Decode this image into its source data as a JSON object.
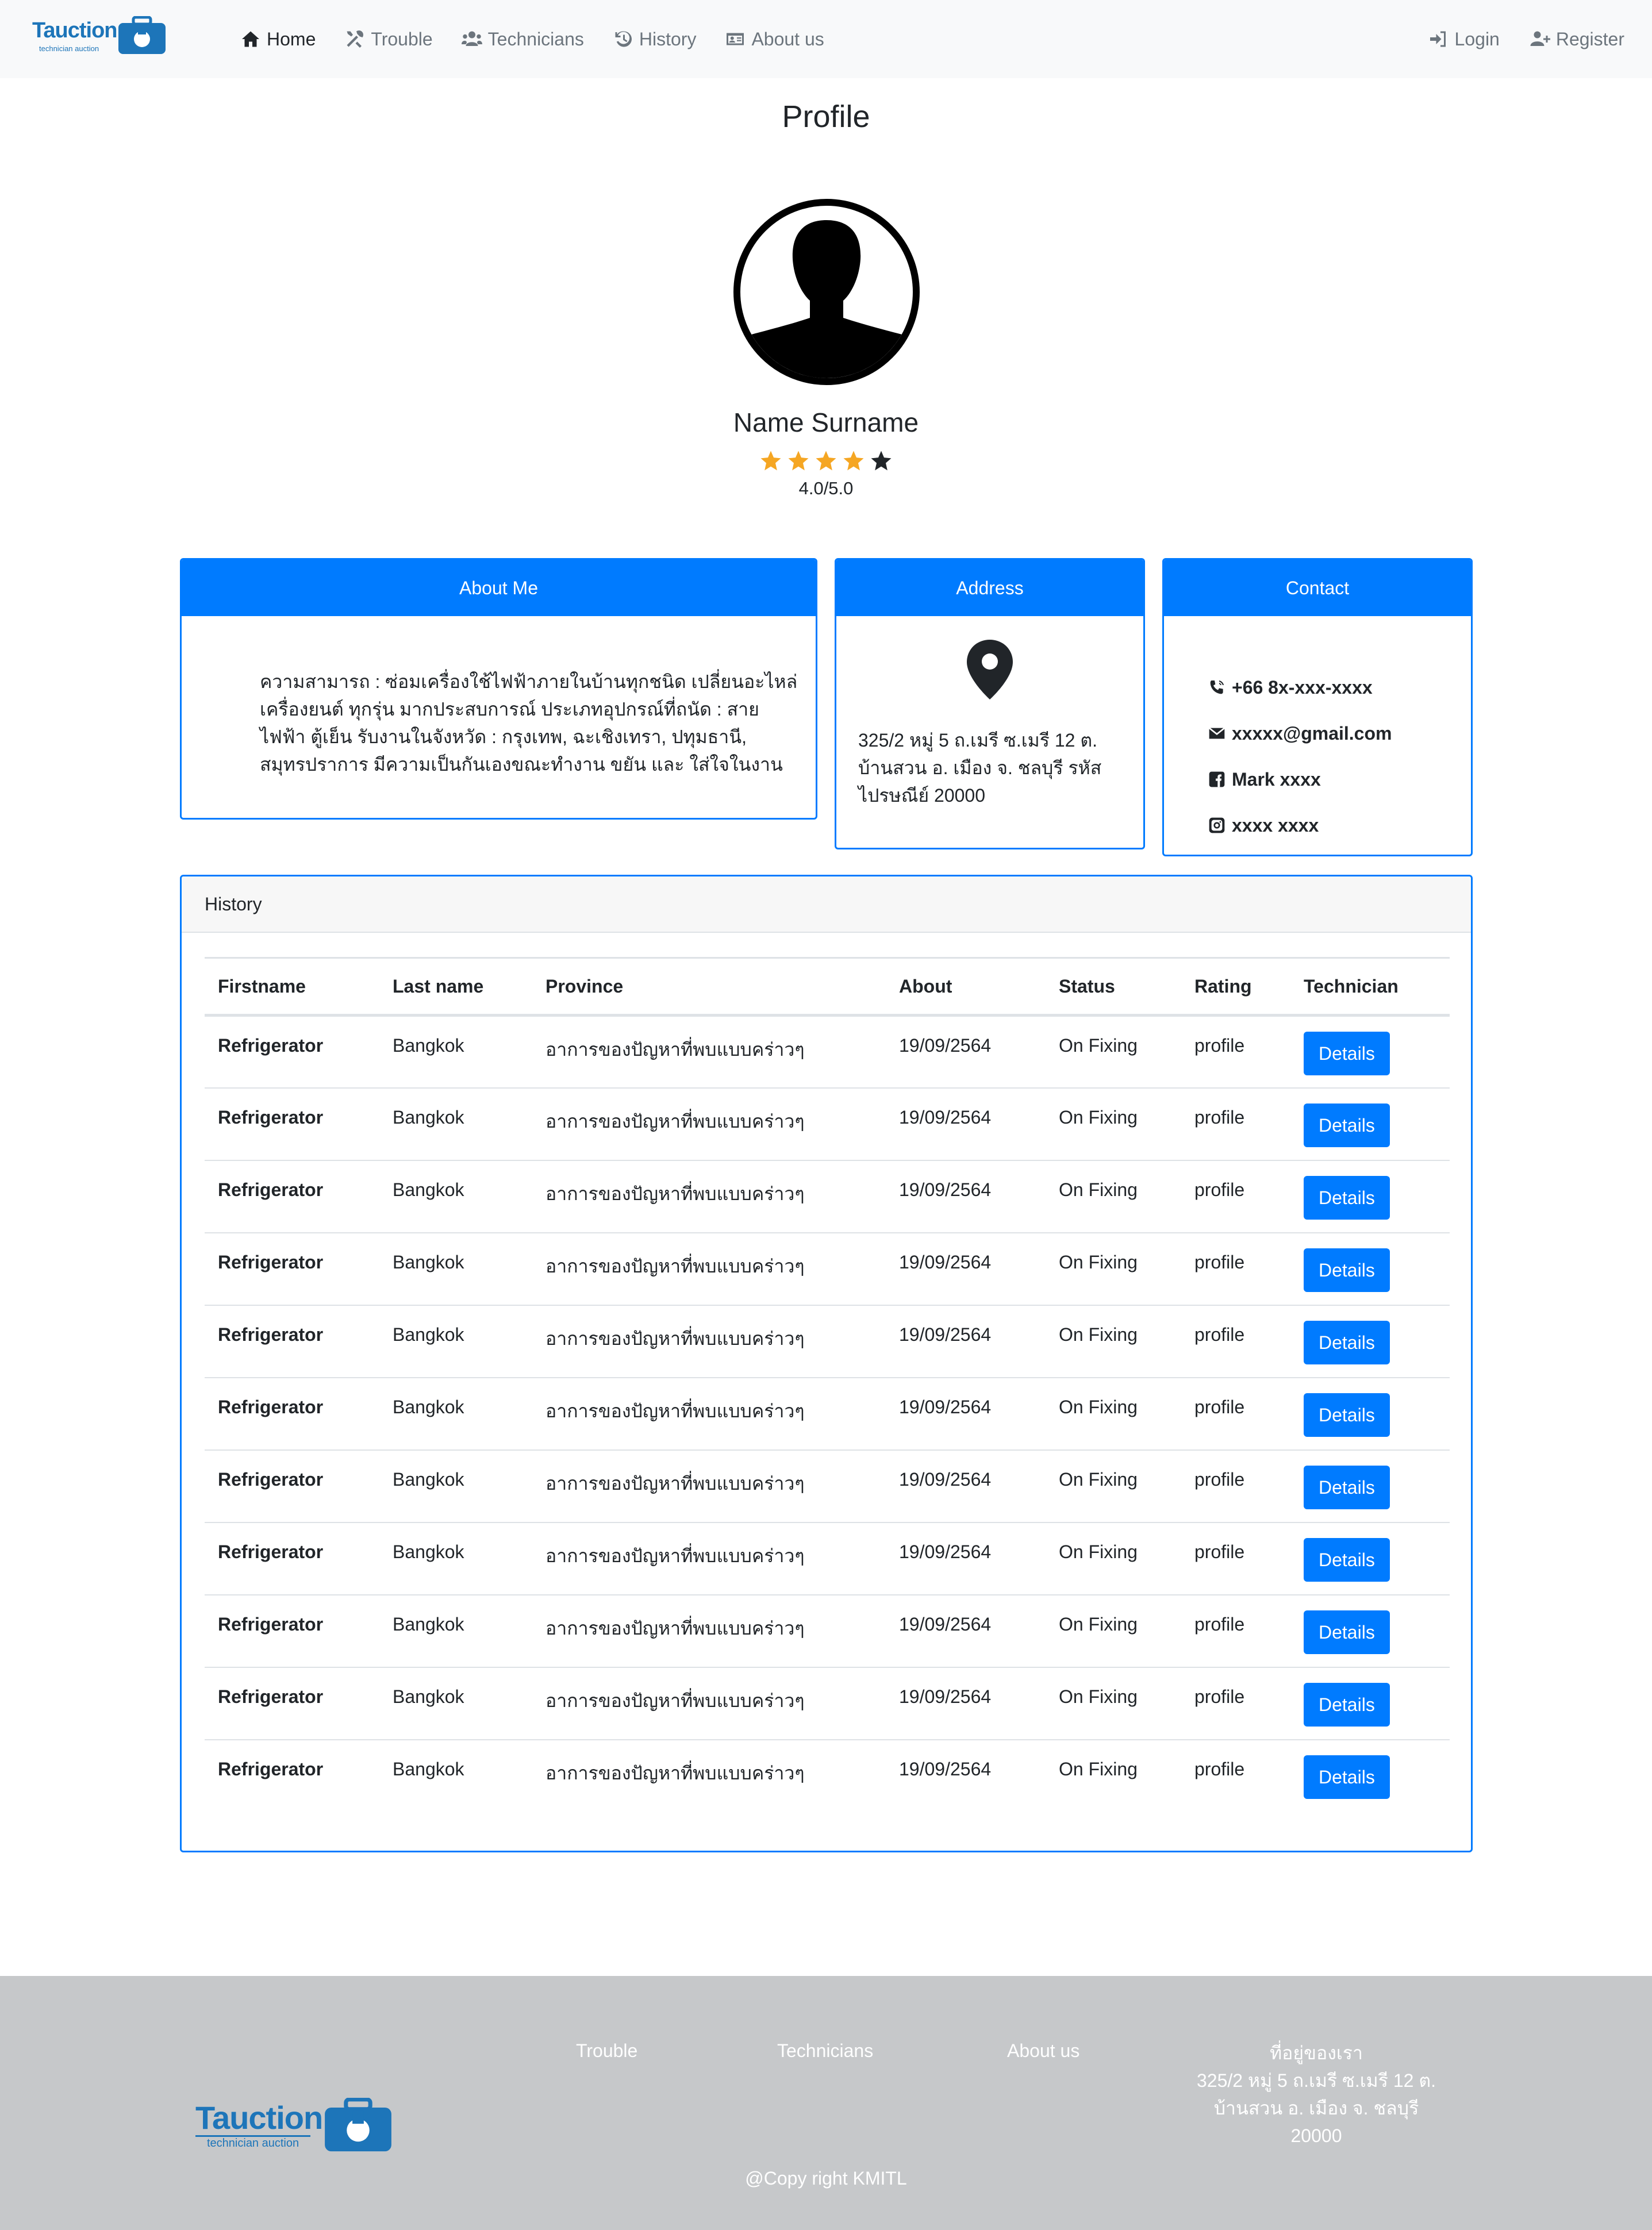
{
  "brand": {
    "name": "Tauction",
    "tagline": "technician auction",
    "color": "#1d75b9"
  },
  "nav": {
    "left": [
      {
        "label": "Home",
        "icon": "home-icon",
        "active": true
      },
      {
        "label": "Trouble",
        "icon": "tools-icon"
      },
      {
        "label": "Technicians",
        "icon": "users-icon"
      },
      {
        "label": "History",
        "icon": "history-icon"
      },
      {
        "label": "About us",
        "icon": "id-card-icon"
      }
    ],
    "right": [
      {
        "label": "Login",
        "icon": "sign-in-icon"
      },
      {
        "label": "Register",
        "icon": "user-plus-icon"
      }
    ]
  },
  "profile": {
    "title": "Profile",
    "name": "Name Surname",
    "rating": 4,
    "rating_max": 5,
    "rating_text": "4.0/5.0",
    "star_color": "#f5a623"
  },
  "about": {
    "header": "About Me",
    "text": "ความสามารถ : ซ่อมเครื่องใช้ไฟฟ้าภายในบ้านทุกชนิด เปลี่ยนอะไหล่เครื่องยนต์ ทุกรุ่น มากประสบการณ์ ประเภทอุปกรณ์ที่ถนัด : สายไฟฟ้า ตู้เย็น รับงานในจังหวัด : กรุงเทพ, ฉะเชิงเทรา, ปทุมธานี, สมุทรปราการ มีความเป็นกันเองขณะทำงาน ขยัน และ ใส่ใจในงาน"
  },
  "address": {
    "header": "Address",
    "text": "325/2 หมู่ 5 ถ.เมรี ซ.เมรี 12 ต. บ้านสวน อ. เมือง จ. ชลบุรี รหัสไปรษณีย์ 20000"
  },
  "contact": {
    "header": "Contact",
    "phone": "+66 8x-xxx-xxxx",
    "email": "xxxxx@gmail.com",
    "facebook": "Mark xxxx",
    "instagram": "xxxx xxxx"
  },
  "history": {
    "header": "History",
    "columns": [
      "Firstname",
      "Last name",
      "Province",
      "About",
      "Status",
      "Rating",
      "Technician"
    ],
    "button_label": "Details",
    "rows": [
      [
        "Refrigerator",
        "Bangkok",
        "อาการของปัญหาที่พบแบบคร่าวๆ",
        "19/09/2564",
        "On Fixing",
        "profile"
      ],
      [
        "Refrigerator",
        "Bangkok",
        "อาการของปัญหาที่พบแบบคร่าวๆ",
        "19/09/2564",
        "On Fixing",
        "profile"
      ],
      [
        "Refrigerator",
        "Bangkok",
        "อาการของปัญหาที่พบแบบคร่าวๆ",
        "19/09/2564",
        "On Fixing",
        "profile"
      ],
      [
        "Refrigerator",
        "Bangkok",
        "อาการของปัญหาที่พบแบบคร่าวๆ",
        "19/09/2564",
        "On Fixing",
        "profile"
      ],
      [
        "Refrigerator",
        "Bangkok",
        "อาการของปัญหาที่พบแบบคร่าวๆ",
        "19/09/2564",
        "On Fixing",
        "profile"
      ],
      [
        "Refrigerator",
        "Bangkok",
        "อาการของปัญหาที่พบแบบคร่าวๆ",
        "19/09/2564",
        "On Fixing",
        "profile"
      ],
      [
        "Refrigerator",
        "Bangkok",
        "อาการของปัญหาที่พบแบบคร่าวๆ",
        "19/09/2564",
        "On Fixing",
        "profile"
      ],
      [
        "Refrigerator",
        "Bangkok",
        "อาการของปัญหาที่พบแบบคร่าวๆ",
        "19/09/2564",
        "On Fixing",
        "profile"
      ],
      [
        "Refrigerator",
        "Bangkok",
        "อาการของปัญหาที่พบแบบคร่าวๆ",
        "19/09/2564",
        "On Fixing",
        "profile"
      ],
      [
        "Refrigerator",
        "Bangkok",
        "อาการของปัญหาที่พบแบบคร่าวๆ",
        "19/09/2564",
        "On Fixing",
        "profile"
      ],
      [
        "Refrigerator",
        "Bangkok",
        "อาการของปัญหาที่พบแบบคร่าวๆ",
        "19/09/2564",
        "On Fixing",
        "profile"
      ]
    ]
  },
  "footer": {
    "links": [
      "Trouble",
      "Technicians",
      "About us"
    ],
    "address_title": "ที่อยู่ของเรา",
    "address_text": "325/2 หมู่ 5 ถ.เมรี ซ.เมรี 12 ต. บ้านสวน อ. เมือง จ. ชลบุรี 20000",
    "copyright": "@Copy right KMITL"
  },
  "colors": {
    "primary": "#007bff",
    "navbar_bg": "#f8f9fa",
    "footer_bg": "#c6c8ca"
  }
}
